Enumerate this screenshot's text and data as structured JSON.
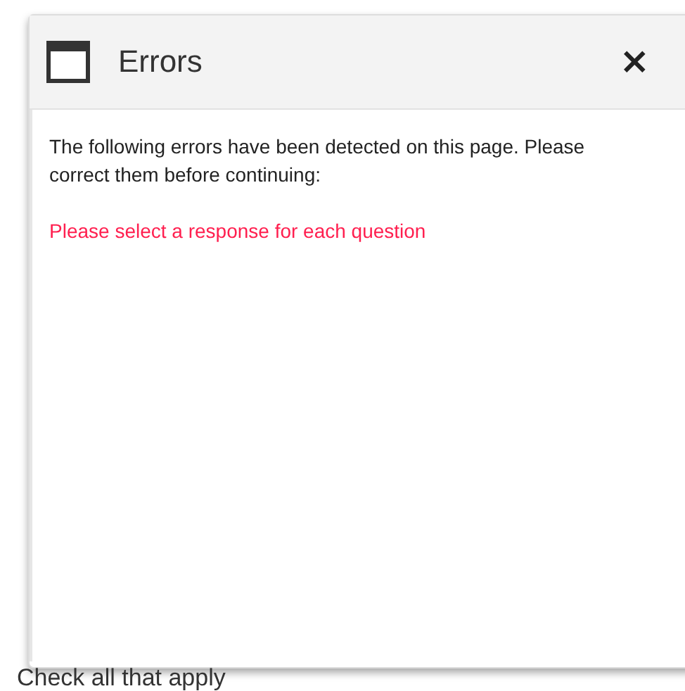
{
  "dialog": {
    "title": "Errors",
    "close": "×",
    "message": "The following errors have been detected on this page. Please correct them before continuing:",
    "errors": [
      "Please select a response for each question"
    ]
  },
  "page": {
    "instruction": "Check all that apply"
  }
}
